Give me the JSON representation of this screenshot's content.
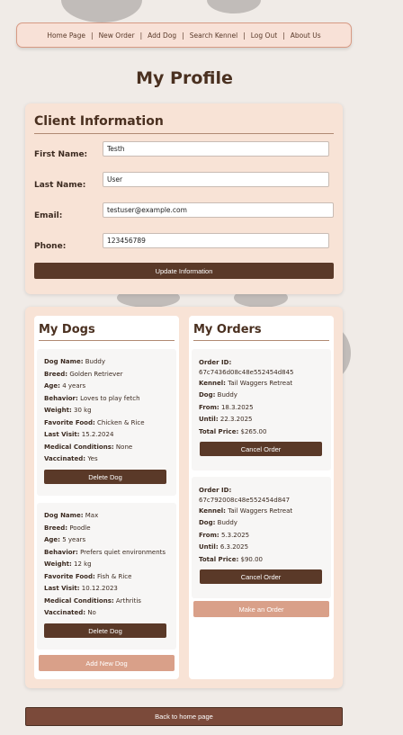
{
  "nav": {
    "items": [
      "Home Page",
      "New Order",
      "Add Dog",
      "Search Kennel",
      "Log Out",
      "About Us"
    ],
    "separator": "|"
  },
  "page_title": "My Profile",
  "client": {
    "heading": "Client Information",
    "first_name_label": "First Name:",
    "first_name_value": "Testh",
    "last_name_label": "Last Name:",
    "last_name_value": "User",
    "email_label": "Email:",
    "email_value": "testuser@example.com",
    "phone_label": "Phone:",
    "phone_value": "123456789",
    "update_button": "Update Information"
  },
  "dogs": {
    "heading": "My Dogs",
    "labels": {
      "name": "Dog Name:",
      "breed": "Breed:",
      "age": "Age:",
      "behavior": "Behavior:",
      "weight": "Weight:",
      "food": "Favorite Food:",
      "visit": "Last Visit:",
      "medical": "Medical Conditions:",
      "vaccinated": "Vaccinated:"
    },
    "items": [
      {
        "name": "Buddy",
        "breed": "Golden Retriever",
        "age": "4 years",
        "behavior": "Loves to play fetch",
        "weight": "30 kg",
        "food": "Chicken & Rice",
        "visit": "15.2.2024",
        "medical": "None",
        "vaccinated": "Yes",
        "delete_button": "Delete Dog"
      },
      {
        "name": "Max",
        "breed": "Poodle",
        "age": "5 years",
        "behavior": "Prefers quiet environments",
        "weight": "12 kg",
        "food": "Fish & Rice",
        "visit": "10.12.2023",
        "medical": "Arthritis",
        "vaccinated": "No",
        "delete_button": "Delete Dog"
      }
    ],
    "add_button": "Add New Dog"
  },
  "orders": {
    "heading": "My Orders",
    "labels": {
      "id": "Order ID:",
      "kennel": "Kennel:",
      "dog": "Dog:",
      "from": "From:",
      "until": "Until:",
      "price": "Total Price:"
    },
    "items": [
      {
        "id": "67c7436d08c48e552454d845",
        "kennel": "Tail Waggers Retreat",
        "dog": "Buddy",
        "from": "18.3.2025",
        "until": "22.3.2025",
        "price": "$265.00",
        "cancel_button": "Cancel Order"
      },
      {
        "id": "67c792008c48e552454d847",
        "kennel": "Tail Waggers Retreat",
        "dog": "Buddy",
        "from": "5.3.2025",
        "until": "6.3.2025",
        "price": "$90.00",
        "cancel_button": "Cancel Order"
      }
    ],
    "make_button": "Make an Order"
  },
  "back_button": "Back to home page",
  "colors": {
    "background": "#f0ebe7",
    "card": "#f8e3d6",
    "dark_button": "#5a3928",
    "light_button": "#d9a089",
    "back_button": "#7b4a3a"
  }
}
